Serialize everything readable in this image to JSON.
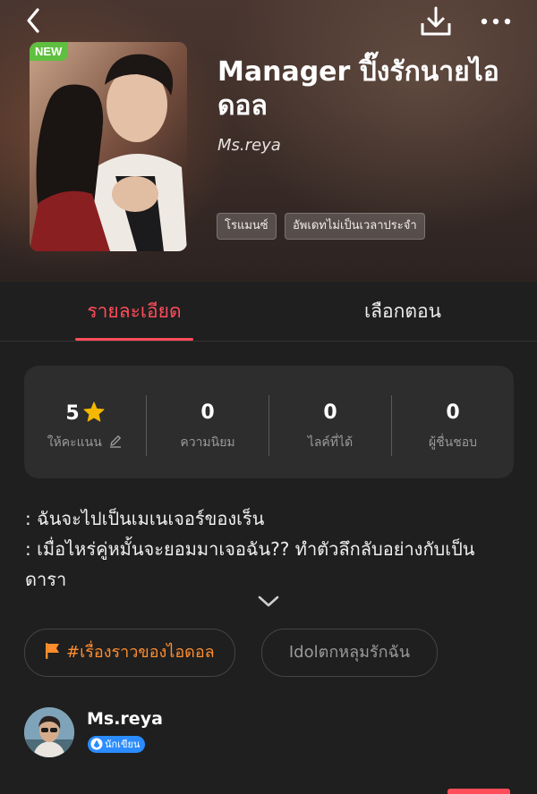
{
  "topbar": {
    "back_icon": "chevron-left-icon",
    "download_icon": "download-icon",
    "more_icon": "more-horizontal-icon"
  },
  "book": {
    "badge": "NEW",
    "title": "Manager ปิ๊งรักนายไอดอล",
    "author": "Ms.reya",
    "tags": [
      "โรแมนซ์",
      "อัพเดทไม่เป็นเวลาประจำ"
    ]
  },
  "tabs": [
    {
      "label": "รายละเอียด",
      "active": true
    },
    {
      "label": "เลือกตอน",
      "active": false
    }
  ],
  "stats": [
    {
      "value": "5",
      "label": "ให้คะแนน",
      "icon": "star-icon"
    },
    {
      "value": "0",
      "label": "ความนิยม"
    },
    {
      "value": "0",
      "label": "ไลค์ที่ได้"
    },
    {
      "value": "0",
      "label": "ผู้ชื่นชอบ"
    }
  ],
  "synopsis": [
    ": ฉันจะไปเป็นเมเนเจอร์ของเร็น",
    ": เมื่อไหร่คู่หมั้นจะยอมมาเจอฉัน?? ทำตัวลึกลับอย่างกับเป็นดารา"
  ],
  "chips": [
    {
      "label": "#เรื่องราวของไอดอล",
      "icon": "flag-icon"
    },
    {
      "label": "Idolตกหลุมรักฉัน"
    }
  ],
  "writer": {
    "name": "Ms.reya",
    "badge": "นักเขียน"
  },
  "colors": {
    "accent": "#ff4d5a",
    "chip_orange": "#ff8d2d",
    "star": "#f5b800",
    "badge_new": "#5fbf3f",
    "writer_badge": "#2a8cff",
    "background": "#1f1f1f",
    "card": "#2d2d2d"
  }
}
